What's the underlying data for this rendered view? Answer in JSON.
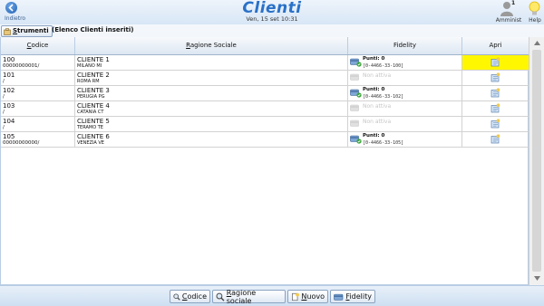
{
  "header": {
    "back_label": "Indietro",
    "title": "Clienti",
    "datetime": "Ven, 15 set 10:31",
    "user_count": "1",
    "user_label": "Amminist",
    "help_label": "Help"
  },
  "toolbar": {
    "tools_label_first": "S",
    "tools_label_rest": "trumenti",
    "subtitle": "(Elenco Clienti inseriti)"
  },
  "table": {
    "columns": [
      {
        "label_first": "C",
        "label_rest": "odice"
      },
      {
        "label_first": "R",
        "label_rest": "agione Sociale"
      },
      {
        "label_first": "",
        "label_rest": "Fidelity"
      },
      {
        "label_first": "",
        "label_rest": "Apri"
      }
    ],
    "rows": [
      {
        "code": "100",
        "code_sub": "00000000001/",
        "name": "CLIENTE 1",
        "city": "MILANO MI",
        "fidelity_points": "Punti: 0",
        "fidelity_card": "[0-4466-33-100]",
        "fidelity_active": true
      },
      {
        "code": "101",
        "code_sub": "/",
        "name": "CLIENTE 2",
        "city": "ROMA RM",
        "fidelity_status": "Non attiva",
        "fidelity_active": false
      },
      {
        "code": "102",
        "code_sub": "/",
        "name": "CLIENTE 3",
        "city": "PERUGIA PG",
        "fidelity_points": "Punti: 0",
        "fidelity_card": "[0-4466-33-102]",
        "fidelity_active": true
      },
      {
        "code": "103",
        "code_sub": "/",
        "name": "CLIENTE 4",
        "city": "CATANIA CT",
        "fidelity_status": "Non attiva",
        "fidelity_active": false
      },
      {
        "code": "104",
        "code_sub": "/",
        "name": "CLIENTE 5",
        "city": "TERAMO TE",
        "fidelity_status": "Non attiva",
        "fidelity_active": false
      },
      {
        "code": "105",
        "code_sub": "00000000000/",
        "name": "CLIENTE 6",
        "city": "VENEZIA VE",
        "fidelity_points": "Punti: 0",
        "fidelity_card": "[0-4466-33-105]",
        "fidelity_active": true
      }
    ]
  },
  "footer": {
    "buttons": [
      {
        "first": "C",
        "rest": "odice",
        "icon": "search-icon"
      },
      {
        "first": "R",
        "rest": "agione sociale",
        "icon": "search-icon"
      },
      {
        "first": "N",
        "rest": "uovo",
        "icon": "new-document-icon"
      },
      {
        "first": "F",
        "rest": "idelity",
        "icon": "fidelity-card-icon"
      }
    ]
  },
  "colors": {
    "title": "#2a71c7",
    "highlight": "#fff700",
    "header_bg": "#d7e6f6"
  }
}
